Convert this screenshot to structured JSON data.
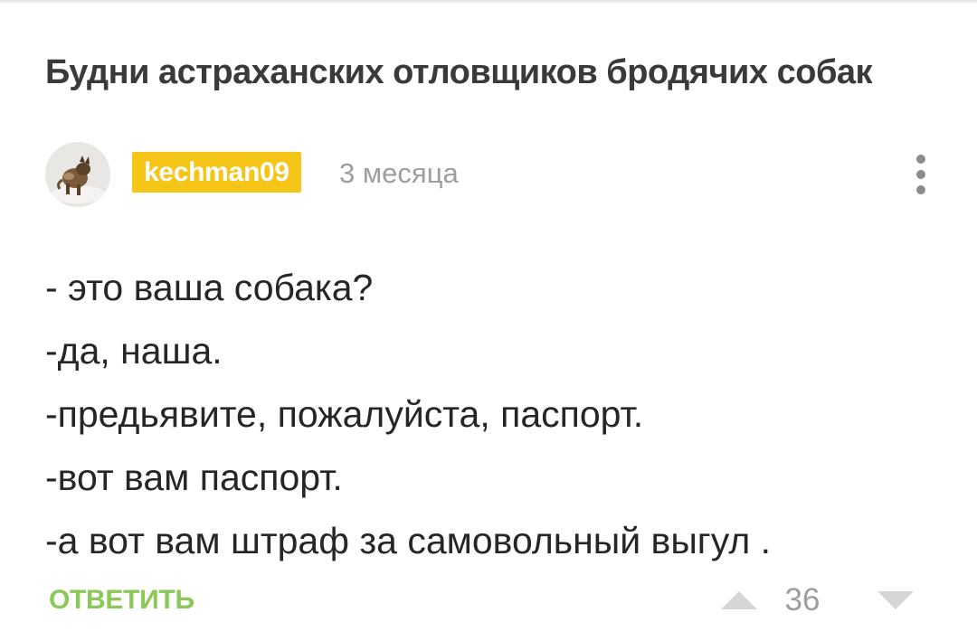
{
  "post": {
    "title": "Будни астраханских отловщиков бродячих собак"
  },
  "comment": {
    "author": "kechman09",
    "time": "3 месяца",
    "lines": [
      "- это ваша собака?",
      "-да, наша.",
      "-предьявите, пожалуйста, паспорт.",
      "-вот вам паспорт.",
      "-а вот вам штраф за самовольный выгул ."
    ],
    "actions": {
      "reply_label": "ОТВЕТИТЬ",
      "rating": "36"
    }
  },
  "icons": {
    "avatar": "dog-photo-avatar",
    "menu": "more-vertical-icon",
    "upvote": "triangle-up-icon",
    "downvote": "triangle-down-icon"
  },
  "colors": {
    "username_badge": "#f5c518",
    "reply": "#8ac858",
    "muted": "#9e9e9e"
  }
}
